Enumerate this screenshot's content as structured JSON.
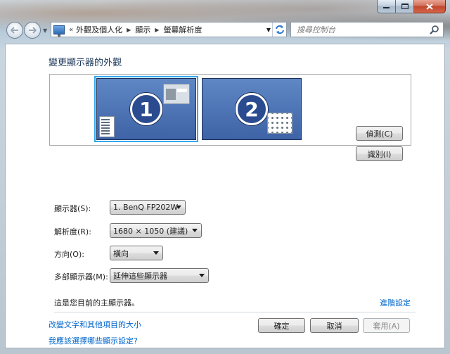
{
  "nav": {
    "breadcrumbs": [
      "外觀及個人化",
      "顯示",
      "螢幕解析度"
    ],
    "overflow_marker": "«"
  },
  "search": {
    "placeholder": "搜尋控制台"
  },
  "page": {
    "title": "變更顯示器的外觀"
  },
  "monitors": [
    {
      "number": "1",
      "selected": true
    },
    {
      "number": "2",
      "selected": false
    }
  ],
  "buttons": {
    "detect": "偵測(C)",
    "identify": "識別(I)",
    "ok": "確定",
    "cancel": "取消",
    "apply": "套用(A)"
  },
  "fields": {
    "display": {
      "label": "顯示器(S):",
      "value": "1. BenQ FP202W"
    },
    "resolution": {
      "label": "解析度(R):",
      "value": "1680 × 1050 (建議)"
    },
    "orientation": {
      "label": "方向(O):",
      "value": "橫向"
    },
    "multiple": {
      "label": "多部顯示器(M):",
      "value": "延伸這些顯示器"
    }
  },
  "info": {
    "primary_text": "這是您目前的主顯示器。",
    "advanced_link": "進階設定"
  },
  "links": {
    "text_size": "改變文字和其他項目的大小",
    "which_settings": "我應該選擇哪些顯示設定?"
  },
  "colors": {
    "link": "#0066cc",
    "heading": "#1e395b",
    "monitor_selected_outline": "#33a8ef"
  }
}
